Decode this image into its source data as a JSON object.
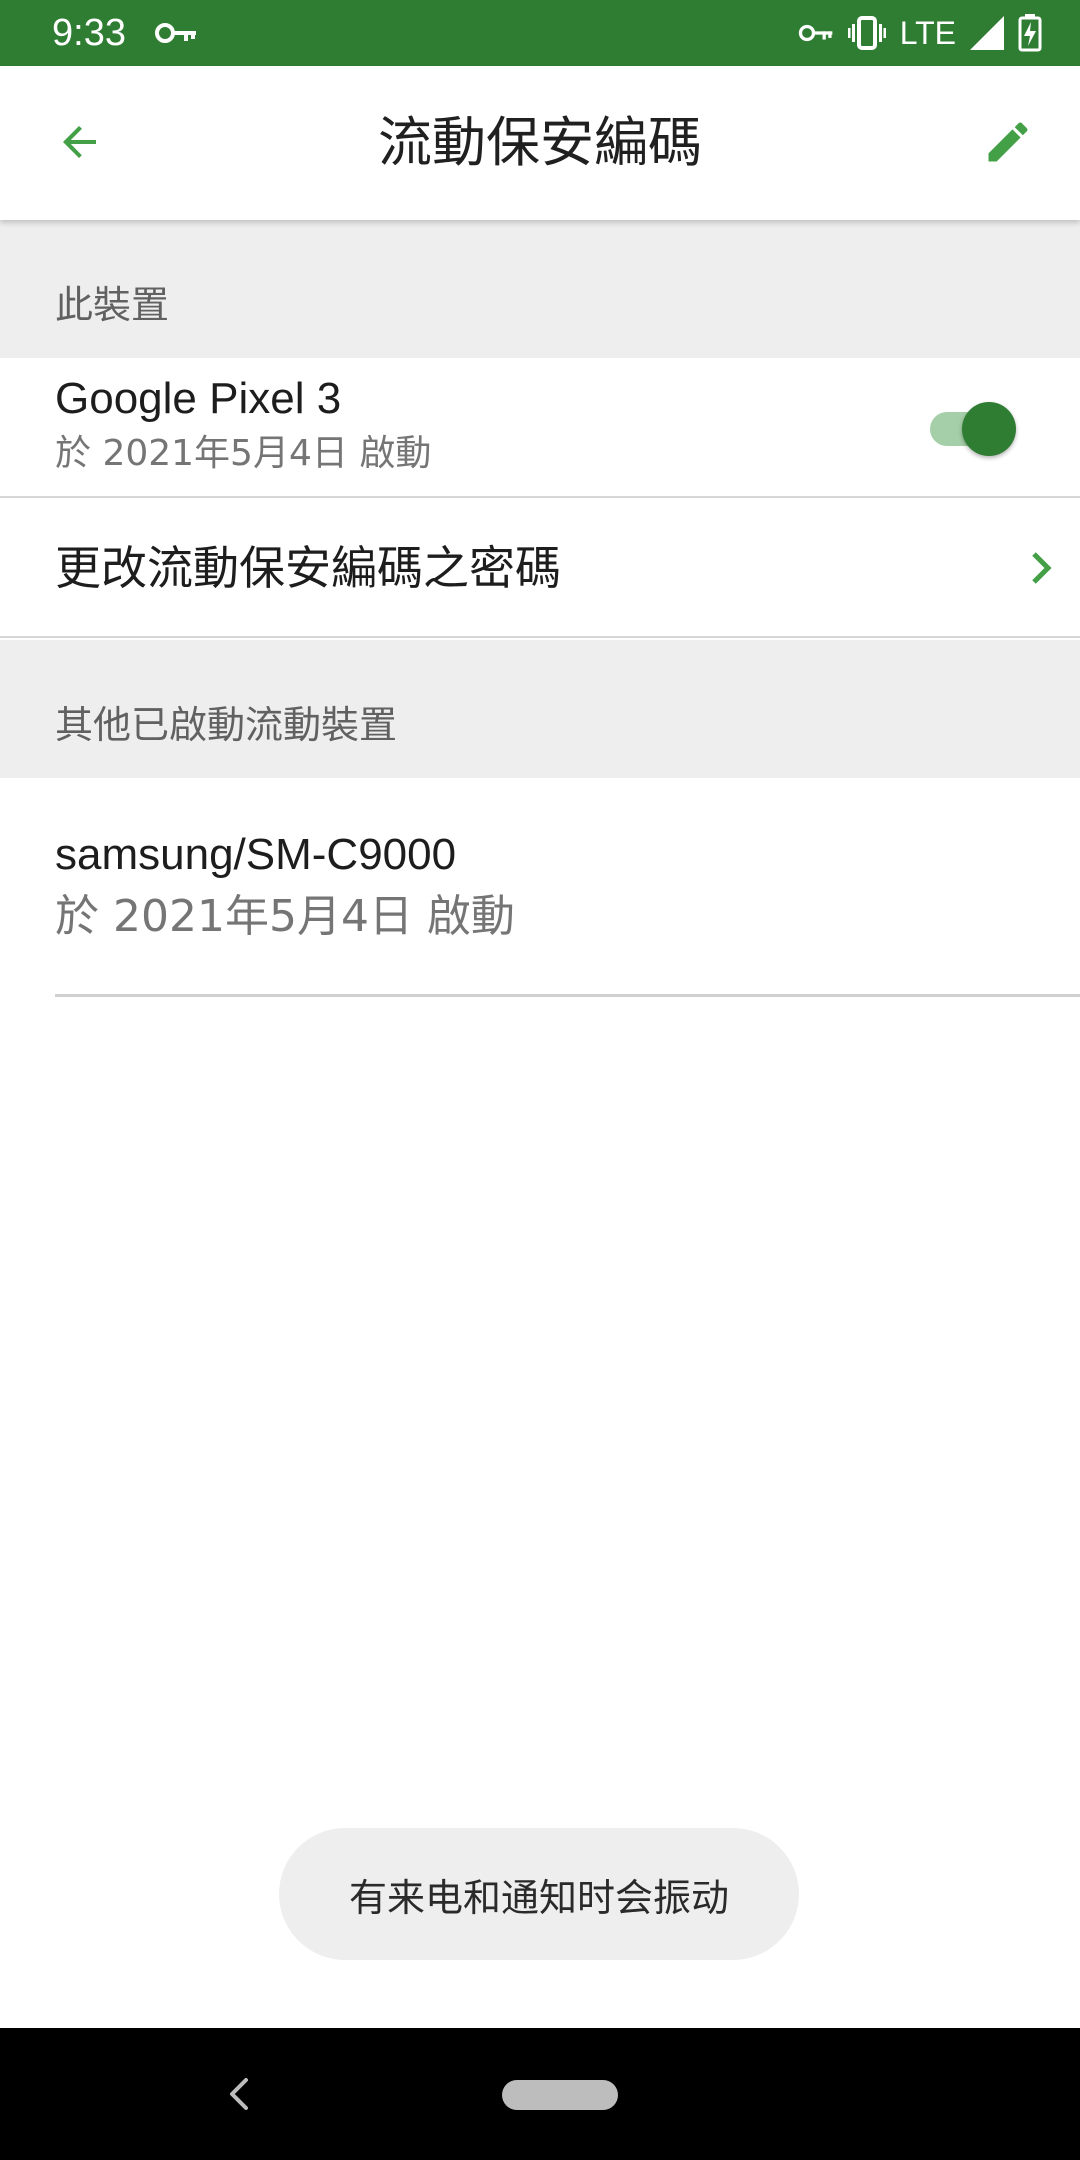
{
  "status_bar": {
    "time": "9:33",
    "network": "LTE",
    "icons": [
      "vpn-key-icon",
      "vibrate-icon",
      "signal-icon",
      "battery-charging-icon"
    ]
  },
  "app_bar": {
    "title": "流動保安編碼",
    "back_icon": "arrow-back-icon",
    "edit_icon": "pencil-icon"
  },
  "this_device": {
    "header": "此裝置",
    "device_name": "Google Pixel 3",
    "activated_text": "於 2021年5月4日 啟動",
    "toggle_on": true
  },
  "change_password": {
    "label": "更改流動保安編碼之密碼"
  },
  "other_devices": {
    "header": "其他已啟動流動裝置",
    "items": [
      {
        "device_name": "samsung/SM-C9000",
        "activated_text": "於 2021年5月4日 啟動"
      }
    ]
  },
  "toast": {
    "text": "有来电和通知时会振动"
  },
  "colors": {
    "primary": "#2e7d32",
    "accent": "#43a047",
    "section_bg": "#eeeeee"
  }
}
